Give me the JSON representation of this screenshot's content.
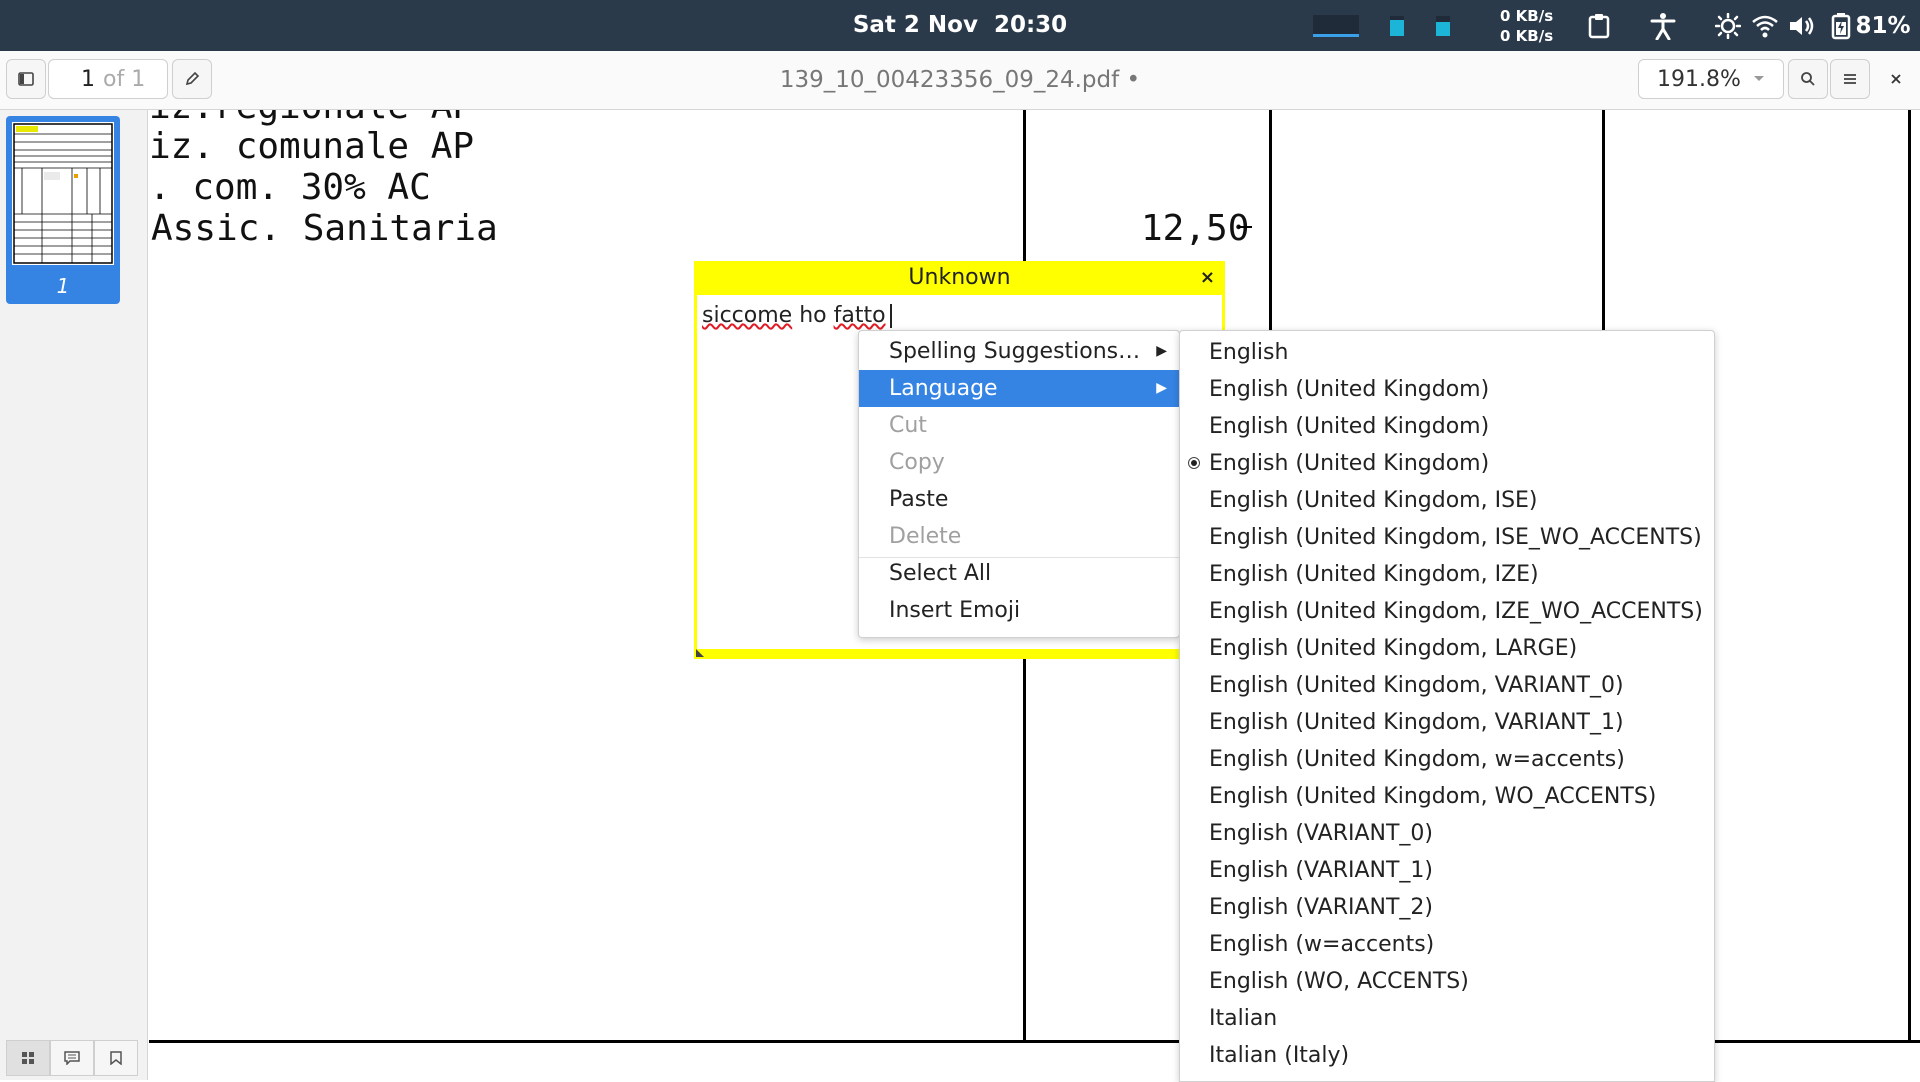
{
  "topbar": {
    "date": "Sat 2 Nov",
    "time": "20:30",
    "net_up": "0 KB/s",
    "net_down": "0 KB/s",
    "battery": "81%"
  },
  "header": {
    "page_current": "1",
    "page_total": "of 1",
    "title": "139_10_00423356_09_24.pdf •",
    "zoom": "191.8%"
  },
  "sidebar": {
    "thumb_label": "1"
  },
  "document": {
    "lines": [
      "iz.regionale AP",
      "iz. comunale AP",
      ". com. 30% AC",
      "Assic. Sanitaria"
    ],
    "amount": "12,50"
  },
  "note": {
    "title": "Unknown",
    "close": "×",
    "word1": "siccome",
    "word2": " ho ",
    "word3": "fatto"
  },
  "context_menu": {
    "items": [
      {
        "label": "Spelling Suggestions…"
      },
      {
        "label": "Language"
      },
      {
        "label": "Cut"
      },
      {
        "label": "Copy"
      },
      {
        "label": "Paste"
      },
      {
        "label": "Delete"
      },
      {
        "label": "Select All"
      },
      {
        "label": "Insert Emoji"
      }
    ]
  },
  "language_menu": {
    "items": [
      "English",
      "English (United Kingdom)",
      "English (United Kingdom)",
      "English (United Kingdom)",
      "English (United Kingdom, ISE)",
      "English (United Kingdom, ISE_WO_ACCENTS)",
      "English (United Kingdom, IZE)",
      "English (United Kingdom, IZE_WO_ACCENTS)",
      "English (United Kingdom, LARGE)",
      "English (United Kingdom, VARIANT_0)",
      "English (United Kingdom, VARIANT_1)",
      "English (United Kingdom, w=accents)",
      "English (United Kingdom, WO_ACCENTS)",
      "English (VARIANT_0)",
      "English (VARIANT_1)",
      "English (VARIANT_2)",
      "English (w=accents)",
      "English (WO, ACCENTS)",
      "Italian",
      "Italian (Italy)"
    ],
    "selected_index": 3
  },
  "colors": {
    "topbar": "#2b3a4a",
    "accent": "#3584e4",
    "note": "#ffff00"
  }
}
